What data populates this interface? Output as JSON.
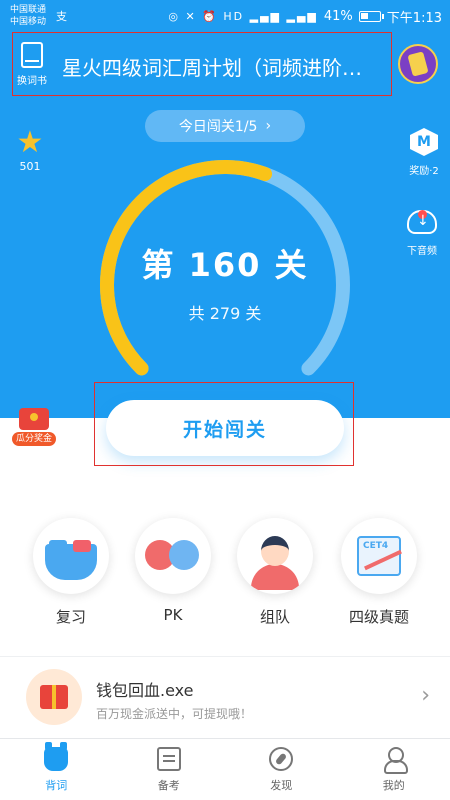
{
  "status_bar": {
    "carrier_1": "中国联通",
    "carrier_2": "中国移动",
    "carrier_extra": "支",
    "icons": "◎ ✕ ⏰ HD ▂▄▆ ▂▄▆",
    "battery": "41%",
    "battery_level": 0.41,
    "time": "下午1:13"
  },
  "header": {
    "switch_book_label": "换词书",
    "book_title": "星火四级词汇周计划（词频进阶…",
    "today_pill": "今日闯关1/5",
    "today_chevron": "›"
  },
  "star": {
    "icon": "★",
    "count": "501"
  },
  "right_rail": {
    "reward_icon_text": "M",
    "reward_label": "奖励·2",
    "download_label": "下音频"
  },
  "progress": {
    "level_text": "第 160 关",
    "total_text": "共 279 关",
    "current": 160,
    "total": 279,
    "track_color": "#7cc6f6",
    "fill_color": "#f9c318"
  },
  "red_packet": {
    "label": "瓜分奖金"
  },
  "start_button": {
    "label": "开始闯关"
  },
  "tiles": [
    {
      "label": "复习"
    },
    {
      "label": "PK"
    },
    {
      "label": "组队"
    },
    {
      "label": "四级真题",
      "badge": "CET4"
    }
  ],
  "promo": {
    "title": "钱包回血.exe",
    "subtitle": "百万现金派送中，可提现哦！",
    "chevron": "›"
  },
  "bottom_nav": [
    {
      "label": "背词"
    },
    {
      "label": "备考"
    },
    {
      "label": "发现"
    },
    {
      "label": "我的"
    }
  ],
  "colors": {
    "primary_blue": "#1e9df1",
    "accent_yellow": "#f9c318",
    "highlight_red": "#e0322f"
  }
}
